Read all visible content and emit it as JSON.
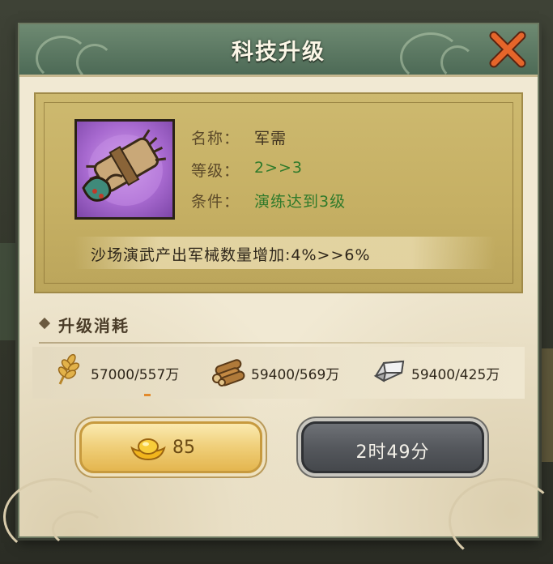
{
  "dialog": {
    "title": "科技升级",
    "close_icon": "close-x-icon"
  },
  "item": {
    "icon": "military-supplies-icon",
    "name_label": "名称：",
    "name_value": "军需",
    "level_label": "等级：",
    "level_value": "2>>3",
    "cond_label": "条件：",
    "cond_value": "演练达到3级",
    "effect": "沙场演武产出军械数量增加:4%>>6%"
  },
  "cost": {
    "title": "升级消耗",
    "resources": [
      {
        "icon": "wheat-icon",
        "text": "57000/557万"
      },
      {
        "icon": "wood-logs-icon",
        "text": "59400/569万"
      },
      {
        "icon": "iron-ingot-icon",
        "text": "59400/425万"
      }
    ]
  },
  "buttons": {
    "gold_icon": "gold-ingot-icon",
    "gold_cost": "85",
    "time_text": "2时49分"
  },
  "colors": {
    "header": "#5c7a63",
    "panel": "#c6b064",
    "green_text": "#2f7a2b",
    "gold_button": "#efce78",
    "gray_button": "#55585d"
  }
}
